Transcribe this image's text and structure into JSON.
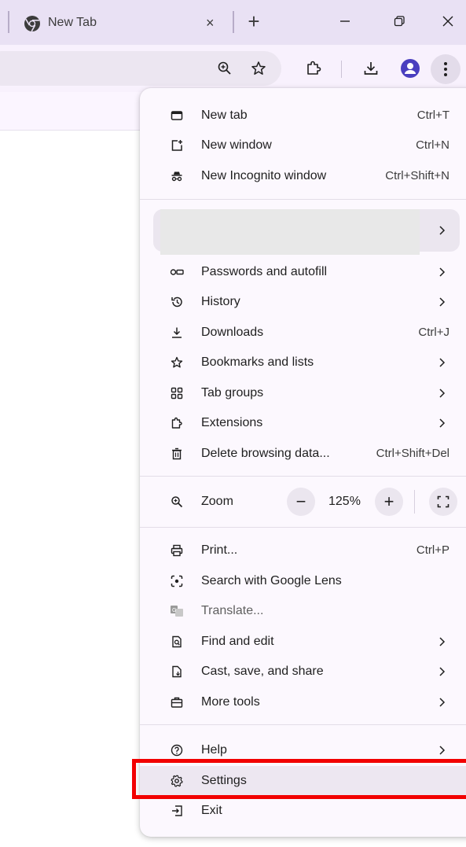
{
  "tab": {
    "title": "New Tab",
    "close": "×"
  },
  "newtab_label": "+",
  "menu": {
    "top_items": [
      {
        "icon": "new-tab-icon",
        "label": "New tab",
        "shortcut": "Ctrl+T"
      },
      {
        "icon": "new-window-icon",
        "label": "New window",
        "shortcut": "Ctrl+N"
      },
      {
        "icon": "incognito-icon",
        "label": "New Incognito window",
        "shortcut": "Ctrl+Shift+N"
      }
    ],
    "middle_items": [
      {
        "icon": "key-icon",
        "label": "Passwords and autofill",
        "submenu": true
      },
      {
        "icon": "history-icon",
        "label": "History",
        "submenu": true
      },
      {
        "icon": "download-icon",
        "label": "Downloads",
        "shortcut": "Ctrl+J"
      },
      {
        "icon": "star-icon",
        "label": "Bookmarks and lists",
        "submenu": true
      },
      {
        "icon": "tab-groups-icon",
        "label": "Tab groups",
        "submenu": true
      },
      {
        "icon": "puzzle-icon",
        "label": "Extensions",
        "submenu": true
      },
      {
        "icon": "trash-icon",
        "label": "Delete browsing data...",
        "shortcut": "Ctrl+Shift+Del"
      }
    ],
    "zoom": {
      "label": "Zoom",
      "minus": "−",
      "value": "125%",
      "plus": "+"
    },
    "tool_items": [
      {
        "icon": "printer-icon",
        "label": "Print...",
        "shortcut": "Ctrl+P"
      },
      {
        "icon": "lens-icon",
        "label": "Search with Google Lens"
      },
      {
        "icon": "translate-icon",
        "label": "Translate...",
        "disabled": true
      },
      {
        "icon": "find-icon",
        "label": "Find and edit",
        "submenu": true
      },
      {
        "icon": "cast-icon",
        "label": "Cast, save, and share",
        "submenu": true
      },
      {
        "icon": "toolbox-icon",
        "label": "More tools",
        "submenu": true
      }
    ],
    "bottom_items": [
      {
        "icon": "help-icon",
        "label": "Help",
        "submenu": true
      },
      {
        "icon": "gear-icon",
        "label": "Settings",
        "highlighted": true
      },
      {
        "icon": "exit-icon",
        "label": "Exit"
      }
    ]
  },
  "colors": {
    "highlight_box": "#f20000",
    "menu_bg": "#fcf8fe",
    "tabstrip_bg": "#e9e1f4",
    "avatar": "#4a3fbf"
  }
}
